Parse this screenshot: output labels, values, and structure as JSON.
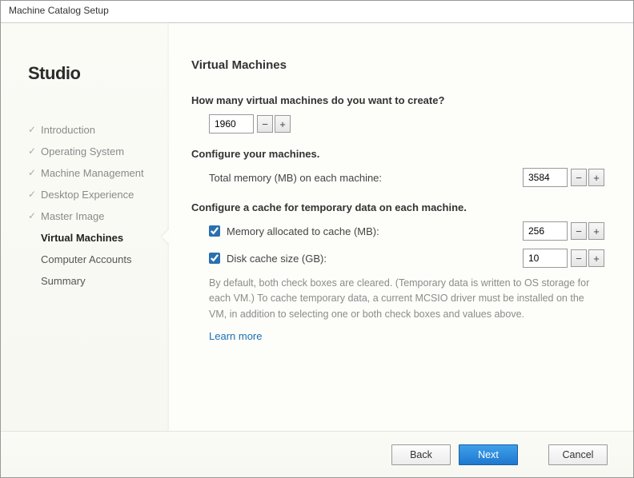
{
  "window": {
    "title": "Machine Catalog Setup"
  },
  "sidebar": {
    "brand": "Studio",
    "steps": [
      {
        "label": "Introduction",
        "state": "done"
      },
      {
        "label": "Operating System",
        "state": "done"
      },
      {
        "label": "Machine Management",
        "state": "done"
      },
      {
        "label": "Desktop Experience",
        "state": "done"
      },
      {
        "label": "Master Image",
        "state": "done"
      },
      {
        "label": "Virtual Machines",
        "state": "current"
      },
      {
        "label": "Computer Accounts",
        "state": "upcoming"
      },
      {
        "label": "Summary",
        "state": "upcoming"
      }
    ]
  },
  "main": {
    "heading": "Virtual Machines",
    "vm_count": {
      "question": "How many virtual machines do you want to create?",
      "value": "1960"
    },
    "configure_heading": "Configure your machines.",
    "total_memory": {
      "label": "Total memory (MB) on each machine:",
      "value": "3584"
    },
    "cache_heading": "Configure a cache for temporary data on each machine.",
    "cache_memory": {
      "checked": true,
      "label": "Memory allocated to cache (MB):",
      "value": "256"
    },
    "cache_disk": {
      "checked": true,
      "label": "Disk cache size (GB):",
      "value": "10"
    },
    "note": "By default, both check boxes are cleared. (Temporary data is written to OS storage for each VM.) To cache temporary data, a current MCSIO driver must be installed on the VM, in addition to selecting one or both check boxes and values above.",
    "learn_more": "Learn more"
  },
  "footer": {
    "back": "Back",
    "next": "Next",
    "cancel": "Cancel"
  },
  "glyph": {
    "minus": "−",
    "plus": "+"
  }
}
